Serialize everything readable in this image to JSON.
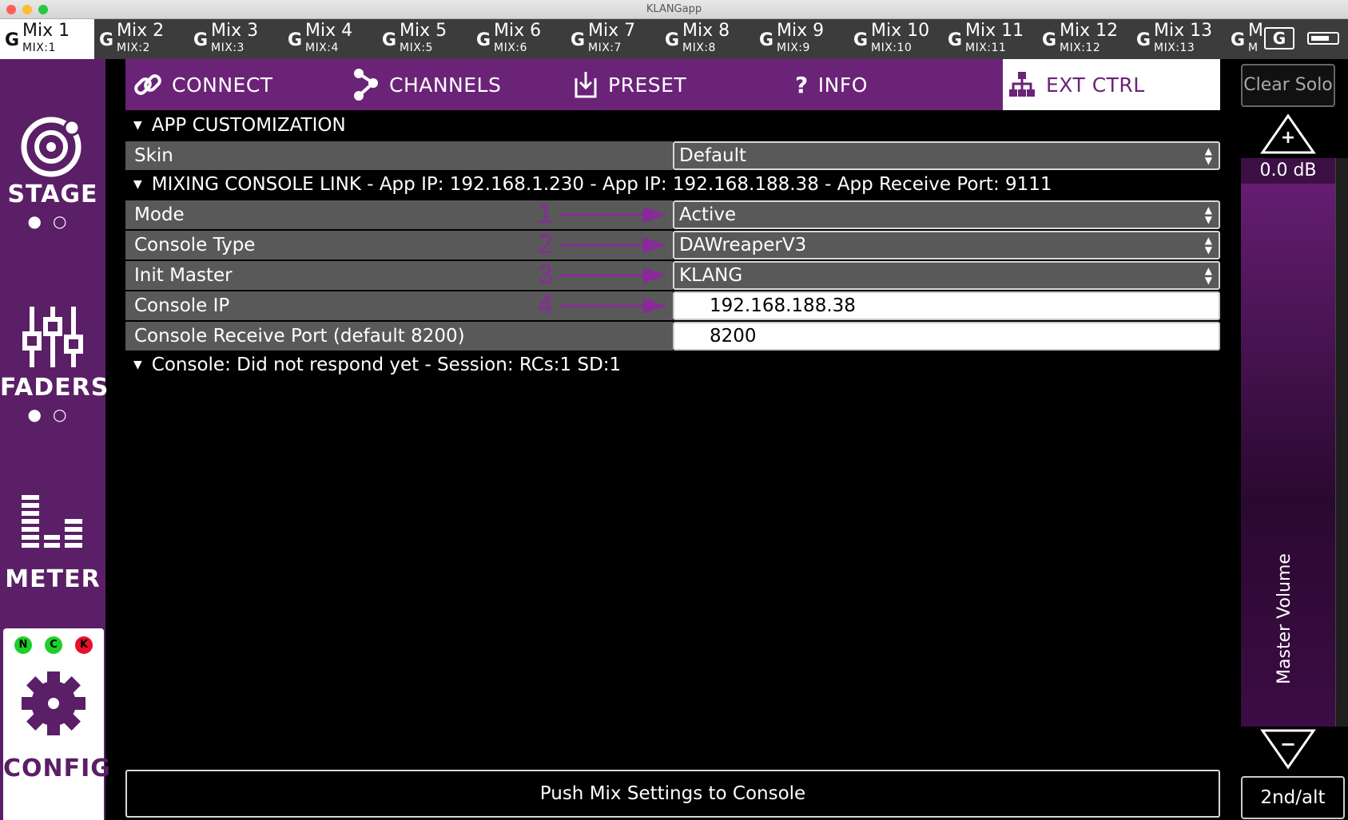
{
  "window": {
    "title": "KLANGapp"
  },
  "mix_tabs": [
    {
      "name": "Mix 1",
      "sub": "MIX:1"
    },
    {
      "name": "Mix 2",
      "sub": "MIX:2"
    },
    {
      "name": "Mix 3",
      "sub": "MIX:3"
    },
    {
      "name": "Mix 4",
      "sub": "MIX:4"
    },
    {
      "name": "Mix 5",
      "sub": "MIX:5"
    },
    {
      "name": "Mix 6",
      "sub": "MIX:6"
    },
    {
      "name": "Mix 7",
      "sub": "MIX:7"
    },
    {
      "name": "Mix 8",
      "sub": "MIX:8"
    },
    {
      "name": "Mix 9",
      "sub": "MIX:9"
    },
    {
      "name": "Mix 10",
      "sub": "MIX:10"
    },
    {
      "name": "Mix 11",
      "sub": "MIX:11"
    },
    {
      "name": "Mix 12",
      "sub": "MIX:12"
    },
    {
      "name": "Mix 13",
      "sub": "MIX:13"
    },
    {
      "name": "M",
      "sub": "M"
    }
  ],
  "mix_tab_glyph": "G",
  "sidebar": {
    "stage": "STAGE",
    "faders": "FADERS",
    "meter": "METER",
    "config": "CONFIG",
    "status": [
      "N",
      "C",
      "K"
    ]
  },
  "nav": {
    "connect": "CONNECT",
    "channels": "CHANNELS",
    "preset": "PRESET",
    "info": "INFO",
    "ext_ctrl": "EXT CTRL"
  },
  "sections": {
    "app_customization": "APP CUSTOMIZATION",
    "mixing_console_link": "MIXING CONSOLE LINK - App IP: 192.168.1.230 - App IP: 192.168.188.38 - App Receive Port: 9111",
    "console_status": "Console: Did not respond yet - Session:  RCs:1 SD:1"
  },
  "settings": {
    "skin": {
      "label": "Skin",
      "value": "Default"
    },
    "mode": {
      "label": "Mode",
      "value": "Active",
      "annotation": "1"
    },
    "console_type": {
      "label": "Console Type",
      "value": "DAWreaperV3",
      "annotation": "2"
    },
    "init_master": {
      "label": "Init Master",
      "value": "KLANG",
      "annotation": "3"
    },
    "console_ip": {
      "label": "Console IP",
      "value": "192.168.188.38",
      "annotation": "4"
    },
    "console_port": {
      "label": "Console Receive Port (default 8200)",
      "value": "8200"
    }
  },
  "push_button": "Push Mix Settings to Console",
  "right_panel": {
    "clear_solo": "Clear Solo",
    "plus": "+",
    "minus": "−",
    "volume": "0.0 dB",
    "master_label": "Master Volume",
    "alt_button": "2nd/alt"
  },
  "colors": {
    "accent": "#6b2378",
    "sidebar": "#5a1f66",
    "annotation": "#8a2a9a",
    "row_bg": "#595959"
  }
}
